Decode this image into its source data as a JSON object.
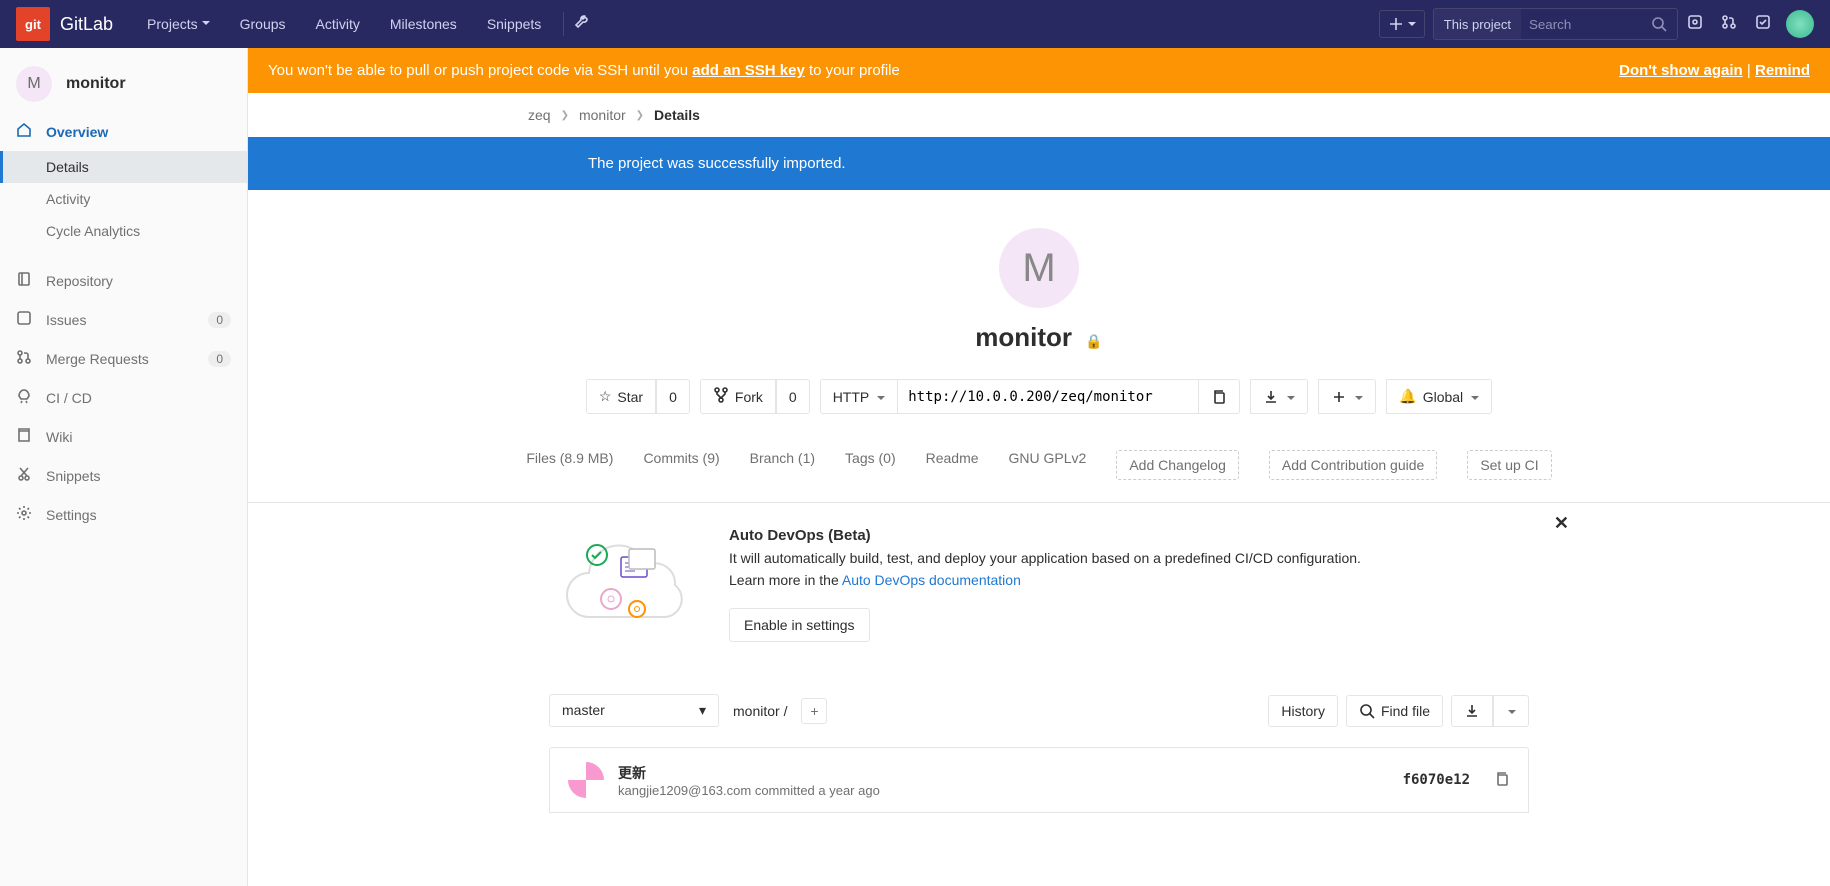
{
  "topnav": {
    "brand": "GitLab",
    "links": [
      "Projects",
      "Groups",
      "Activity",
      "Milestones",
      "Snippets"
    ],
    "search_scope": "This project",
    "search_placeholder": "Search"
  },
  "sidebar": {
    "project_initial": "M",
    "project_name": "monitor",
    "items": [
      {
        "icon": "home",
        "label": "Overview",
        "active": true,
        "sub": [
          {
            "label": "Details",
            "active": true
          },
          {
            "label": "Activity"
          },
          {
            "label": "Cycle Analytics"
          }
        ]
      },
      {
        "icon": "repo",
        "label": "Repository"
      },
      {
        "icon": "issues",
        "label": "Issues",
        "badge": "0"
      },
      {
        "icon": "merge",
        "label": "Merge Requests",
        "badge": "0"
      },
      {
        "icon": "ci",
        "label": "CI / CD"
      },
      {
        "icon": "wiki",
        "label": "Wiki"
      },
      {
        "icon": "snip",
        "label": "Snippets"
      },
      {
        "icon": "gear",
        "label": "Settings"
      }
    ]
  },
  "banner": {
    "pre": "You won't be able to pull or push project code via SSH until you ",
    "link": "add an SSH key",
    "post": " to your profile",
    "dismiss": "Don't show again",
    "remind": "Remind"
  },
  "breadcrumbs": {
    "a": "zeq",
    "b": "monitor",
    "c": "Details"
  },
  "flash": "The project was successfully imported.",
  "hero": {
    "initial": "M",
    "name": "monitor"
  },
  "actions": {
    "star": "Star",
    "star_count": "0",
    "fork": "Fork",
    "fork_count": "0",
    "proto": "HTTP",
    "clone_url": "http://10.0.0.200/zeq/monitor",
    "notif": "Global"
  },
  "stats": {
    "files": "Files (8.9 MB)",
    "commits": "Commits (9)",
    "branch": "Branch (1)",
    "tags": "Tags (0)",
    "readme": "Readme",
    "license": "GNU GPLv2",
    "changelog": "Add Changelog",
    "contrib": "Add Contribution guide",
    "ci": "Set up CI"
  },
  "devops": {
    "title": "Auto DevOps (Beta)",
    "desc": "It will automatically build, test, and deploy your application based on a predefined CI/CD configuration.",
    "learn_pre": "Learn more in the ",
    "learn_link": "Auto DevOps documentation",
    "enable": "Enable in settings"
  },
  "tree": {
    "branch": "master",
    "path": "monitor",
    "history": "History",
    "find": "Find file"
  },
  "commit": {
    "msg": "更新",
    "author": "kangjie1209@163.com",
    "when": "committed a year ago",
    "sha": "f6070e12"
  }
}
